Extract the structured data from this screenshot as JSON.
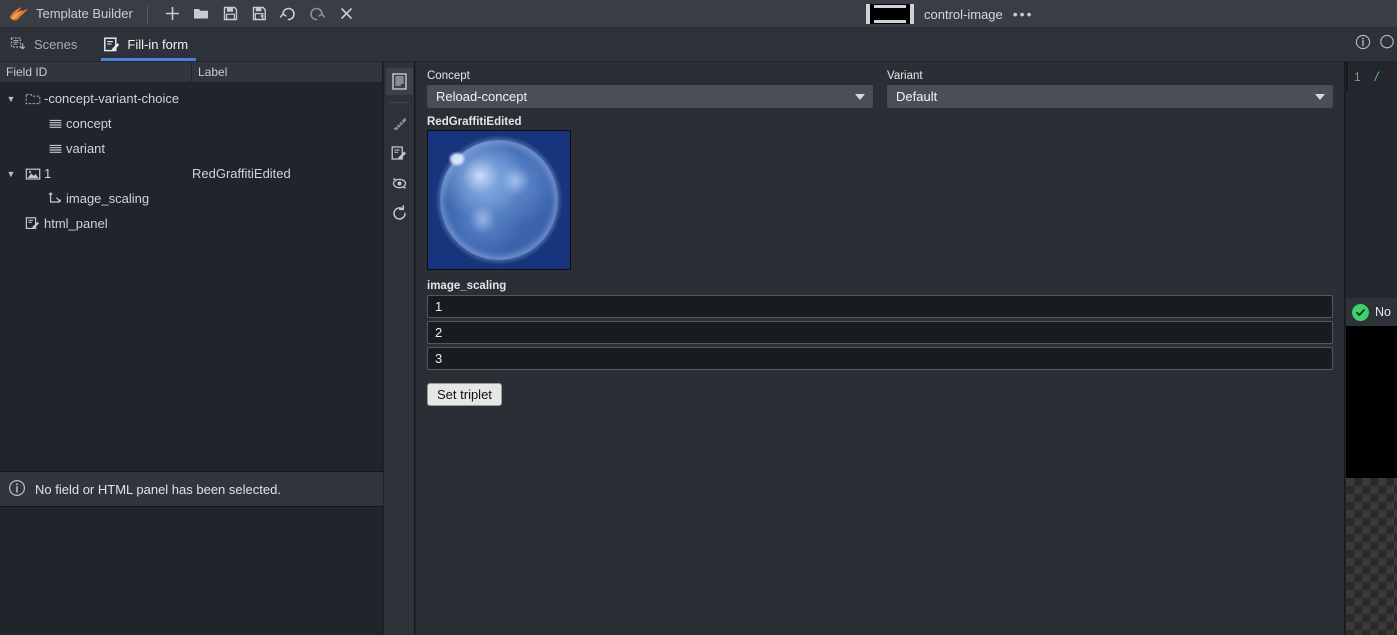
{
  "titlebar": {
    "app_name": "Template Builder",
    "logo_icon": "flame-logo-icon",
    "buttons": [
      {
        "name": "new-button",
        "icon": "plus-icon",
        "label": "New"
      },
      {
        "name": "open-button",
        "icon": "folder-open-icon",
        "label": "Open"
      },
      {
        "name": "save-button",
        "icon": "save-icon",
        "label": "Save"
      },
      {
        "name": "save-as-button",
        "icon": "save-as-icon",
        "label": "Save As"
      },
      {
        "name": "undo-button",
        "icon": "undo-icon",
        "label": "Undo"
      },
      {
        "name": "redo-button",
        "icon": "redo-icon",
        "label": "Redo"
      },
      {
        "name": "close-button",
        "icon": "close-x-icon",
        "label": "Close"
      }
    ],
    "document": {
      "icon": "film-strip-icon",
      "name": "control-image",
      "overflow_menu": "•••"
    }
  },
  "tabs": [
    {
      "label": "Scenes",
      "icon": "scenes-icon",
      "active": false
    },
    {
      "label": "Fill-in form",
      "icon": "fill-in-form-icon",
      "active": true
    }
  ],
  "tree": {
    "columns": {
      "field_id": "Field ID",
      "label": "Label"
    },
    "rows": [
      {
        "id": "-concept-variant-choice",
        "label": "",
        "icon": "folder-icon",
        "twisty": "▼",
        "indent": 0,
        "has_twisty": true
      },
      {
        "id": "concept",
        "label": "",
        "icon": "list-lines-icon",
        "twisty": "",
        "indent": 1,
        "has_twisty": false
      },
      {
        "id": "variant",
        "label": "",
        "icon": "list-lines-icon",
        "twisty": "",
        "indent": 1,
        "has_twisty": false
      },
      {
        "id": "1",
        "label": "RedGraffitiEdited",
        "icon": "image-icon",
        "twisty": "▼",
        "indent": 0,
        "has_twisty": true
      },
      {
        "id": "image_scaling",
        "label": "",
        "icon": "transform-axes-icon",
        "twisty": "",
        "indent": 1,
        "has_twisty": false
      },
      {
        "id": "html_panel",
        "label": "",
        "icon": "html-edit-icon",
        "twisty": "",
        "indent": 0,
        "has_twisty": false
      }
    ]
  },
  "info_bar": {
    "icon": "info-circle-icon",
    "message": "No field or HTML panel has been selected."
  },
  "vertical_toolbar": [
    {
      "name": "form-view-button",
      "icon": "form-document-icon",
      "selected": true
    },
    {
      "name": "layout-tool-button",
      "icon": "ruler-triangle-icon",
      "selected": false
    },
    {
      "name": "edit-tool-button",
      "icon": "pencil-edit-icon",
      "selected": false
    },
    {
      "name": "preview-tool-button",
      "icon": "eye-preview-icon",
      "selected": false
    },
    {
      "name": "refresh-tool-button",
      "icon": "refresh-circular-arrow-icon",
      "selected": false
    }
  ],
  "form": {
    "concept": {
      "label": "Concept",
      "value": "Reload-concept"
    },
    "variant": {
      "label": "Variant",
      "value": "Default"
    },
    "image": {
      "label": "RedGraffitiEdited",
      "alt": "blue-sphere-thumbnail"
    },
    "image_scaling": {
      "label": "image_scaling",
      "values": [
        "1",
        "2",
        "3"
      ]
    },
    "set_triplet_button": "Set triplet"
  },
  "editor": {
    "info_icon": "info-circle-icon",
    "search_icon": "search-circle-icon",
    "line_number": "1",
    "line_text": "/",
    "status": {
      "icon": "check-circle-icon",
      "text": "No"
    }
  },
  "colors": {
    "accent_tab": "#4c7fe0",
    "logo_orange": "#e8762b",
    "status_green": "#3fcf6b",
    "panel_bg": "#21252b",
    "titlebar_bg": "#393d44"
  }
}
